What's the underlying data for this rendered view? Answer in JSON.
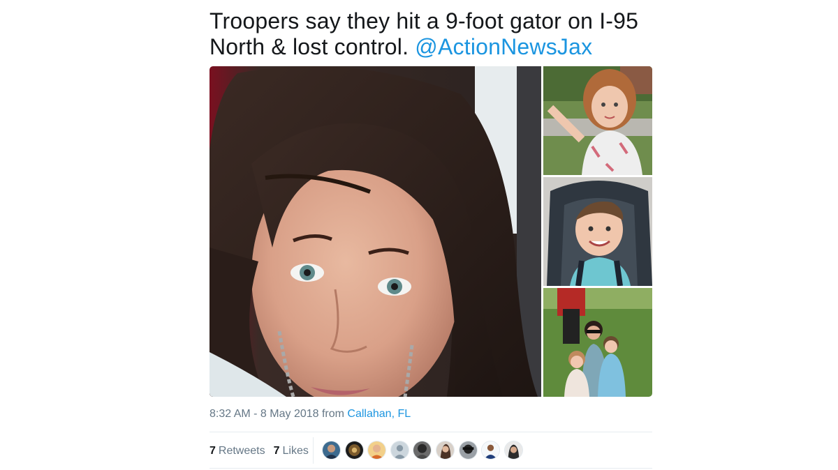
{
  "tweet": {
    "text_line1": "Troopers say they hit a 9-foot gator on I-95",
    "text_line2": "North & lost control. ",
    "mention": "@ActionNewsJax",
    "time": "8:32 AM - 8 May 2018 from ",
    "place": "Callahan, FL",
    "retweets_count": "7",
    "retweets_label": "Retweets",
    "likes_count": "7",
    "likes_label": "Likes"
  },
  "colors": {
    "link": "#1b95e0",
    "text": "#14171a",
    "muted": "#657786",
    "border": "#e6ecf0"
  }
}
